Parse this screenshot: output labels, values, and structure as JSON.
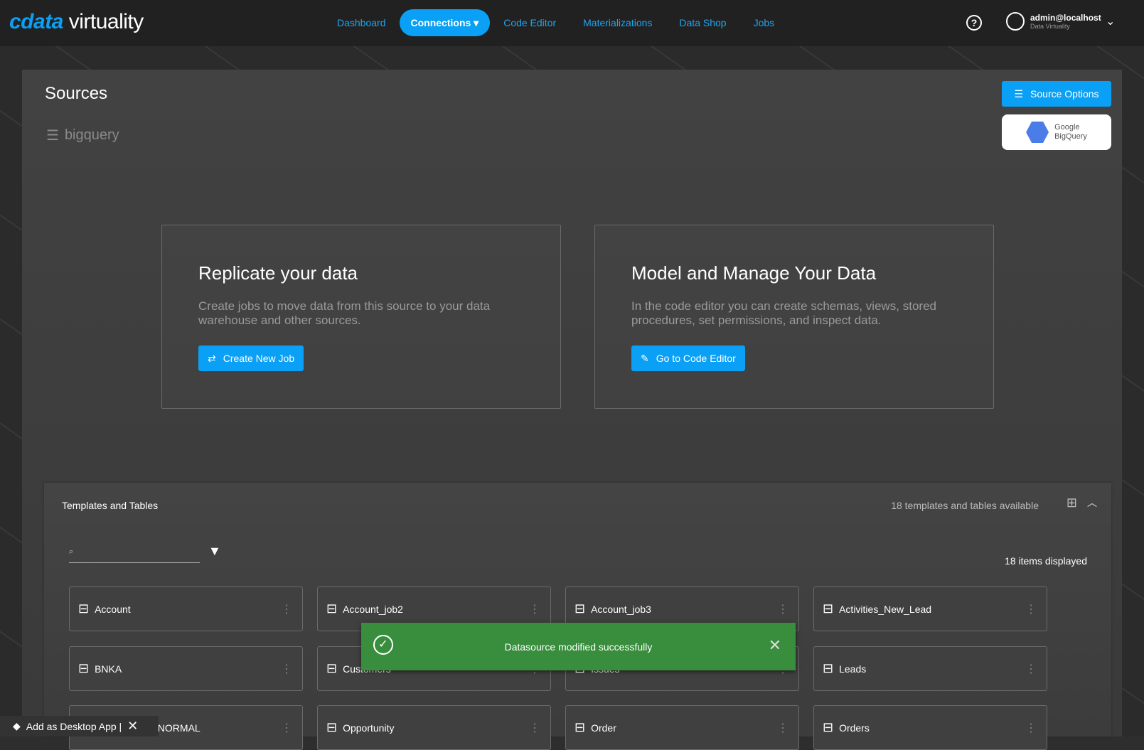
{
  "header": {
    "logo_brand": "cdata",
    "logo_product": "virtuality",
    "nav": [
      "Dashboard",
      "Connections",
      "Code Editor",
      "Materializations",
      "Data Shop",
      "Jobs"
    ],
    "user": "admin@localhost",
    "user_sub": "Data Virtuality"
  },
  "page": {
    "title": "Sources",
    "source_name": "bigquery",
    "source_options": "Source Options",
    "source_type_line1": "Google",
    "source_type_line2": "BigQuery"
  },
  "cards": [
    {
      "title": "Replicate your data",
      "text": "Create jobs to move data from this source to your data warehouse and other sources.",
      "button": "Create New Job"
    },
    {
      "title": "Model and Manage Your Data",
      "text": "In the code editor you can create schemas, views, stored procedures, set permissions, and inspect data.",
      "button": "Go to Code Editor"
    }
  ],
  "templates": {
    "title": "Templates and Tables",
    "count": "18 templates and tables available",
    "displayed": "18 items displayed",
    "search_placeholder": "",
    "items": [
      "Account",
      "Account_job2",
      "Account_job3",
      "Activities_New_Lead",
      "BNKA",
      "Customers",
      "Issues",
      "Leads",
      "_NOPK_TBL_NORMAL",
      "Opportunity",
      "Order",
      "Orders"
    ]
  },
  "toast": {
    "message": "Datasource modified successfully"
  },
  "desktop_app": {
    "label": "Add as Desktop App |"
  },
  "colors": {
    "accent": "#0aa0f5",
    "success": "#388e3c"
  }
}
